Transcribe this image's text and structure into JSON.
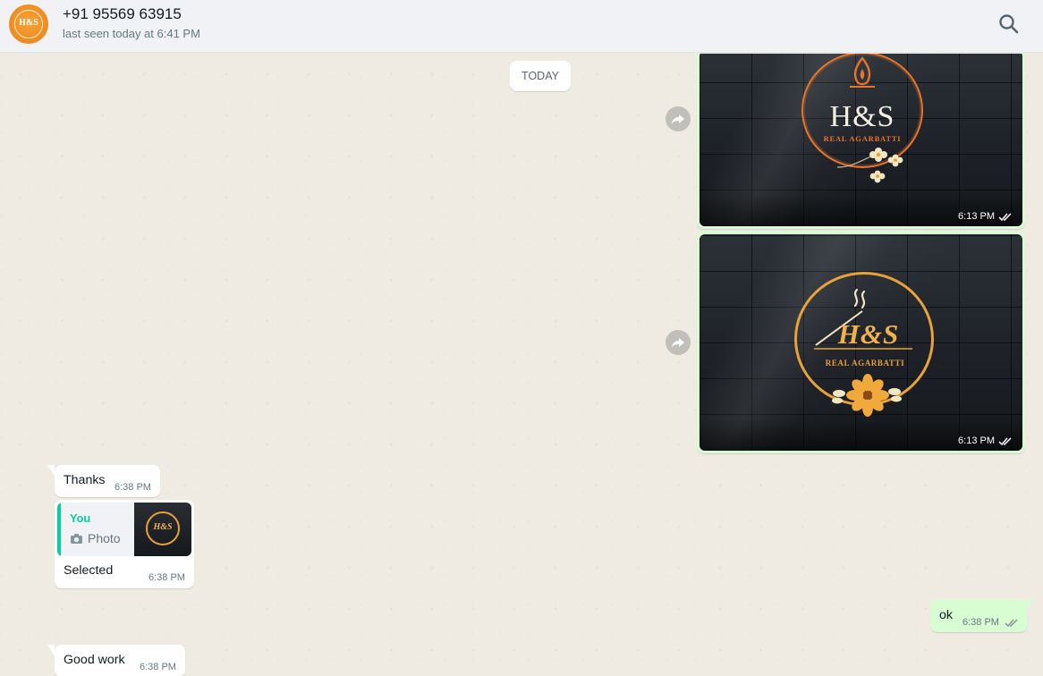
{
  "header": {
    "avatar_text": "H&S",
    "contact_name": "+91 95569 63915",
    "status": "last seen today at 6:41 PM",
    "search_icon": "search-icon"
  },
  "colors": {
    "chat_background": "#efeae2",
    "incoming_bubble": "#ffffff",
    "outgoing_bubble": "#d9fdd3",
    "quote_accent": "#06cf9c",
    "read_ticks": "#8696a0"
  },
  "chat": {
    "date_divider": "TODAY",
    "messages": [
      {
        "direction": "outgoing",
        "type": "image",
        "image": {
          "brand": "H&S",
          "tagline": "REAL AGARBATTI"
        },
        "time": "6:13 PM",
        "status_icon": "double-check-icon"
      },
      {
        "direction": "outgoing",
        "type": "image",
        "image": {
          "brand": "H&S",
          "tagline": "REAL AGARBATTI"
        },
        "time": "6:13 PM",
        "status_icon": "double-check-icon"
      },
      {
        "direction": "incoming",
        "type": "text",
        "text": "Thanks",
        "time": "6:38 PM"
      },
      {
        "direction": "incoming",
        "type": "reply",
        "quote": {
          "author": "You",
          "type": "Photo",
          "thumb_text": "H&S"
        },
        "text": "Selected",
        "time": "6:38 PM"
      },
      {
        "direction": "outgoing",
        "type": "text",
        "text": "ok",
        "time": "6:38 PM",
        "status_icon": "double-check-icon"
      },
      {
        "direction": "incoming",
        "type": "text",
        "text": "Good work",
        "time": "6:38 PM"
      }
    ]
  }
}
